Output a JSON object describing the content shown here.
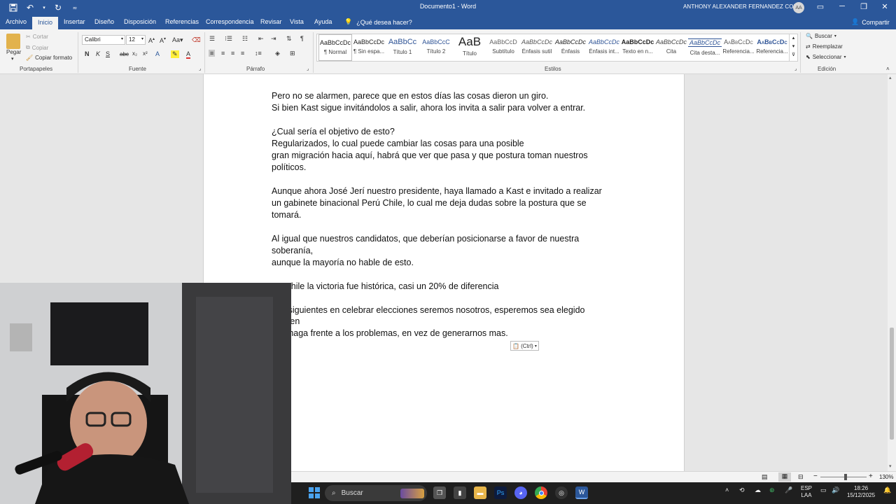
{
  "window": {
    "title": "Documento1 - Word",
    "user_name": "ANTHONY ALEXANDER FERNANDEZ CORI",
    "user_initials": "AA"
  },
  "tabs": [
    "Archivo",
    "Inicio",
    "Insertar",
    "Diseño",
    "Disposición",
    "Referencias",
    "Correspondencia",
    "Revisar",
    "Vista",
    "Ayuda"
  ],
  "active_tab": "Inicio",
  "tell_me": "¿Qué desea hacer?",
  "share_label": "Compartir",
  "ribbon": {
    "clipboard": {
      "paste": "Pegar",
      "cut": "Cortar",
      "copy": "Copiar",
      "format_painter": "Copiar formato",
      "label": "Portapapeles"
    },
    "font": {
      "name": "Calibri",
      "size": "12",
      "label": "Fuente",
      "change_case": "Aa"
    },
    "paragraph": {
      "label": "Párrafo"
    },
    "styles": {
      "label": "Estilos",
      "items": [
        {
          "sample": "AaBbCcDc",
          "name": "¶ Normal"
        },
        {
          "sample": "AaBbCcDc",
          "name": "¶ Sin espa..."
        },
        {
          "sample": "AaBbCc",
          "name": "Título 1"
        },
        {
          "sample": "AaBbCcC",
          "name": "Título 2"
        },
        {
          "sample": "AaB",
          "name": "Título"
        },
        {
          "sample": "AaBbCcD",
          "name": "Subtítulo"
        },
        {
          "sample": "AaBbCcDc",
          "name": "Énfasis sutil"
        },
        {
          "sample": "AaBbCcDc",
          "name": "Énfasis"
        },
        {
          "sample": "AaBbCcDc",
          "name": "Énfasis int..."
        },
        {
          "sample": "AaBbCcDc",
          "name": "Texto en n..."
        },
        {
          "sample": "AaBbCcDc",
          "name": "Cita"
        },
        {
          "sample": "AaBbCcDc",
          "name": "Cita desta..."
        },
        {
          "sample": "AaBbCcDc",
          "name": "Referencia..."
        },
        {
          "sample": "AaBbCcDc",
          "name": "Referencia..."
        }
      ]
    },
    "editing": {
      "find": "Buscar",
      "replace": "Reemplazar",
      "select": "Seleccionar",
      "label": "Edición"
    }
  },
  "document": {
    "lines": [
      "Pero no se alarmen, parece que en estos días las cosas dieron un giro.",
      "Si bien Kast sigue invitándolos a salir, ahora los invita a salir para volver a entrar.",
      "",
      "¿Cual sería el objetivo de esto?",
      "Regularizados, lo cual puede cambiar las cosas para una posible",
      "gran migración hacia aquí, habrá que ver que pasa y que postura toman nuestros",
      "políticos.",
      "",
      "Aunque ahora José Jerí nuestro presidente, haya llamado a Kast e invitado a realizar",
      "un gabinete binacional Perú Chile, lo cual me deja dudas sobre la postura que se",
      "tomará.",
      "",
      "Al igual que nuestros candidatos, que deberían posicionarse a favor de nuestra",
      "soberanía,",
      "aunque la mayoría no hable de esto.",
      "",
      "En Chile la victoria fue histórica, casi un 20% de diferencia",
      "",
      "Los siguientes en celebrar elecciones seremos nosotros, esperemos sea elegido",
      "alguien",
      "que haga frente a los problemas, en vez de generarnos mas."
    ],
    "paste_options": "(Ctrl)"
  },
  "status": {
    "zoom": "130%"
  },
  "taskbar": {
    "search_label": "Buscar",
    "lang": "ESP",
    "lang2": "LAA",
    "time": "18:26",
    "date": "15/12/2025"
  }
}
